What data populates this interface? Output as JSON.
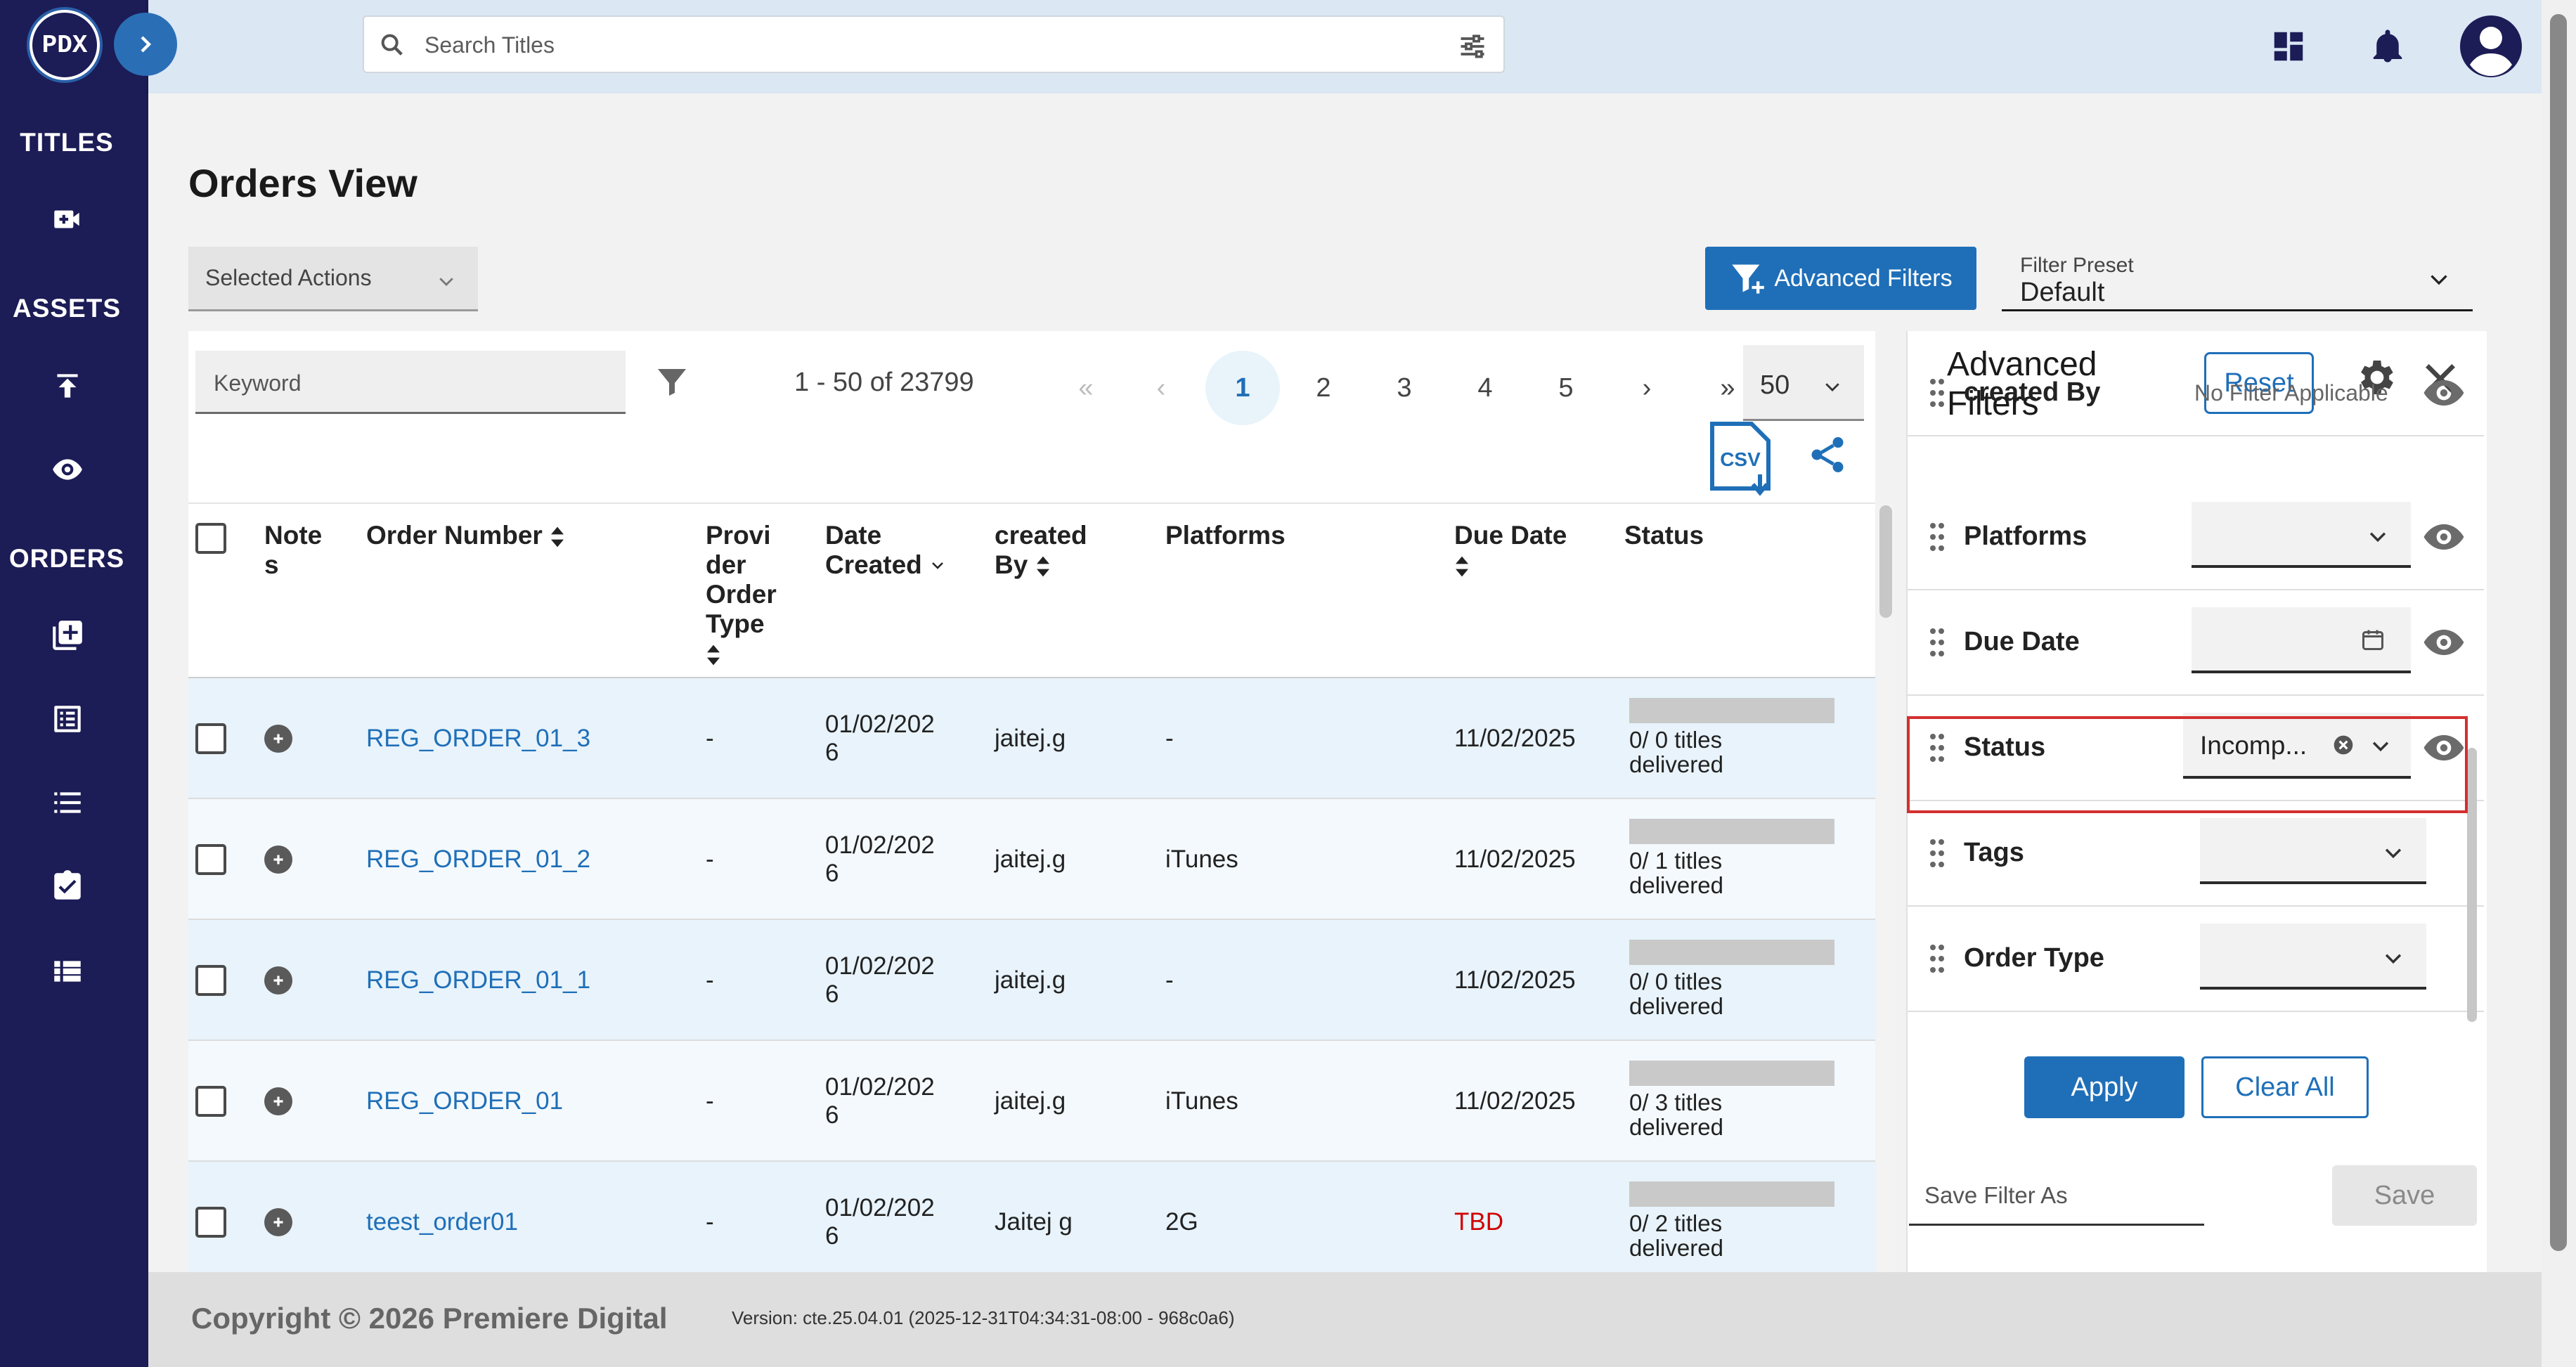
{
  "app": {
    "logo_text": "PDX"
  },
  "sidebar": {
    "sections": [
      {
        "label": "TITLES",
        "icons": [
          "video-add-icon"
        ]
      },
      {
        "label": "ASSETS",
        "icons": [
          "upload-icon",
          "eye-icon"
        ]
      },
      {
        "label": "ORDERS",
        "icons": [
          "library-add-icon",
          "list-alt-icon",
          "format-list-icon",
          "assignment-turned-in-icon",
          "view-list-icon"
        ]
      }
    ]
  },
  "topbar": {
    "search_placeholder": "Search Titles"
  },
  "page": {
    "title": "Orders View",
    "selected_actions": "Selected Actions",
    "advanced_filters_btn": "Advanced Filters",
    "filter_preset_label": "Filter Preset",
    "filter_preset_value": "Default"
  },
  "table_toolbar": {
    "keyword_placeholder": "Keyword",
    "page_info": "1 - 50 of 23799",
    "pages": [
      "1",
      "2",
      "3",
      "4",
      "5"
    ],
    "current_page": "1",
    "first": "«",
    "prev": "‹",
    "next": "›",
    "last": "»",
    "per_page": "50",
    "csv_label": "CSV"
  },
  "table": {
    "columns": {
      "notes": "Note\ns",
      "order_number": "Order Number",
      "provider_order_type": "Provi\nder\nOrder\nType",
      "date_created": "Date\nCreated",
      "created_by": "created\nBy",
      "platforms": "Platforms",
      "due_date": "Due Date",
      "status": "Status"
    },
    "rows": [
      {
        "order": "REG_ORDER_01_3",
        "provider": "-",
        "date": "01/02/202\n6",
        "created_by": "jaitej.g",
        "platforms": "-",
        "due": "11/02/2025",
        "status": "0/ 0 titles\ndelivered",
        "progress": 0
      },
      {
        "order": "REG_ORDER_01_2",
        "provider": "-",
        "date": "01/02/202\n6",
        "created_by": "jaitej.g",
        "platforms": "iTunes",
        "due": "11/02/2025",
        "status": "0/ 1 titles\ndelivered",
        "progress": 0
      },
      {
        "order": "REG_ORDER_01_1",
        "provider": "-",
        "date": "01/02/202\n6",
        "created_by": "jaitej.g",
        "platforms": "-",
        "due": "11/02/2025",
        "status": "0/ 0 titles\ndelivered",
        "progress": 0
      },
      {
        "order": "REG_ORDER_01",
        "provider": "-",
        "date": "01/02/202\n6",
        "created_by": "jaitej.g",
        "platforms": "iTunes",
        "due": "11/02/2025",
        "status": "0/ 3 titles\ndelivered",
        "progress": 0
      },
      {
        "order": "teest_order01",
        "provider": "-",
        "date": "01/02/202\n6",
        "created_by": "Jaitej g",
        "platforms": "2G",
        "due": "TBD",
        "status": "0/ 2 titles\ndelivered",
        "progress": 0
      }
    ]
  },
  "panel": {
    "title": "Advanced\nFilters",
    "reset": "Reset",
    "filters": [
      {
        "label": "created By",
        "value": "No Filter Applicable"
      },
      {
        "label": "Platforms",
        "value": ""
      },
      {
        "label": "Due Date",
        "value": ""
      },
      {
        "label": "Status",
        "value": "Incomp..."
      },
      {
        "label": "Tags",
        "value": ""
      },
      {
        "label": "Order Type",
        "value": ""
      }
    ],
    "apply": "Apply",
    "clear_all": "Clear All",
    "save_filter_placeholder": "Save Filter As",
    "save": "Save"
  },
  "footer": {
    "copyright": "Copyright © 2026 Premiere Digital",
    "version": "Version: cte.25.04.01 (2025-12-31T04:34:31-08:00 - 968c0a6)"
  },
  "colors": {
    "brand_navy": "#1c1c56",
    "accent_blue": "#1f6fb8",
    "highlight_red": "#d32f2f",
    "due_tbd": "#d10000"
  }
}
